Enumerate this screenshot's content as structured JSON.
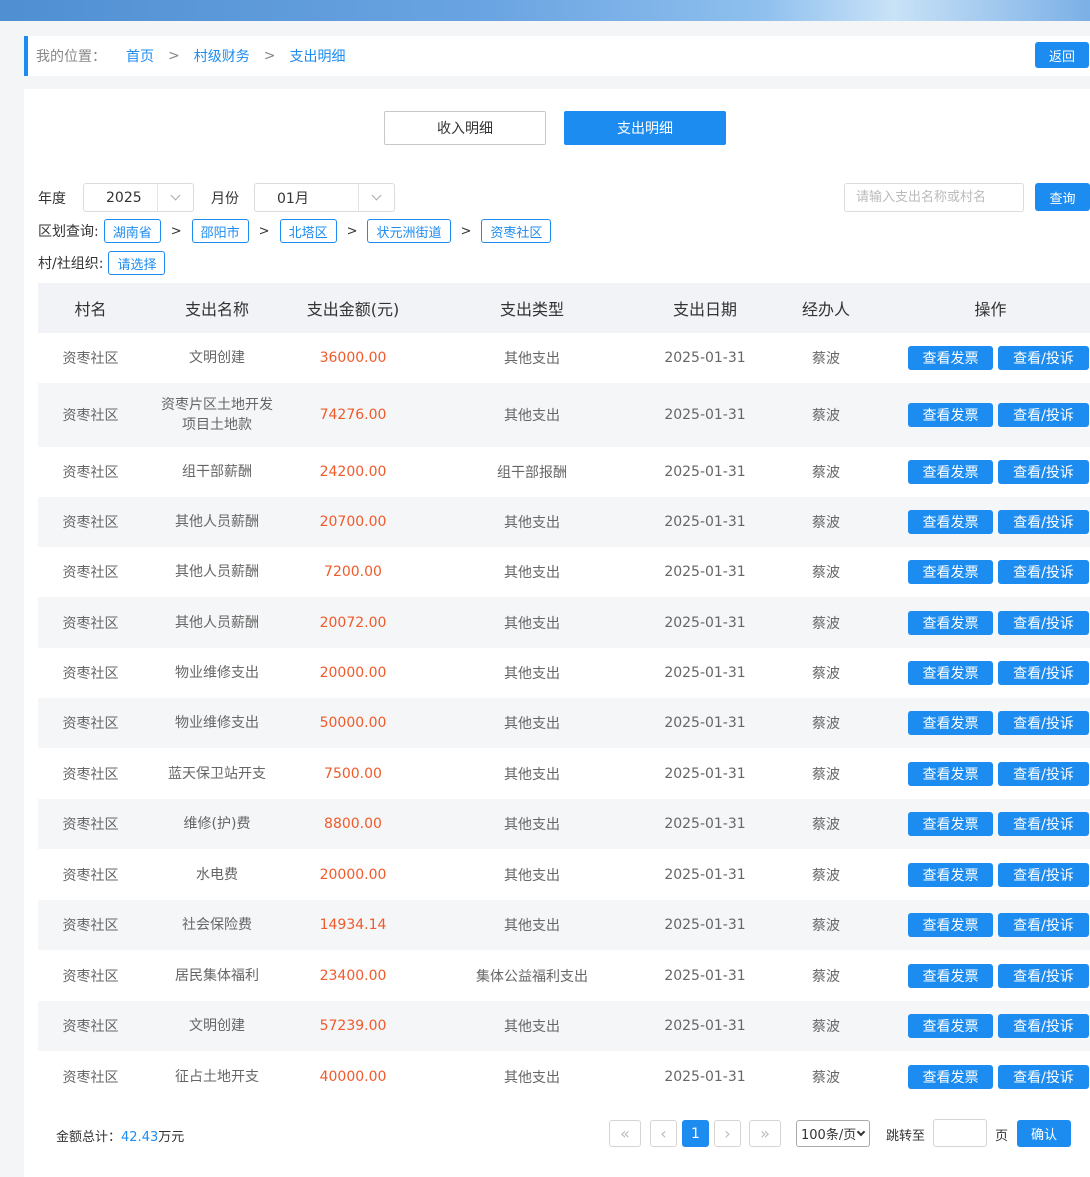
{
  "breadcrumb": {
    "label": "我的位置：",
    "items": [
      "首页",
      "村级财务",
      "支出明细"
    ],
    "separator": ">",
    "back_label": "返回"
  },
  "tabs": {
    "income_label": "收入明细",
    "expense_label": "支出明细"
  },
  "filters": {
    "year_label": "年度",
    "year_value": "2025",
    "month_label": "月份",
    "month_value": "01月",
    "search_placeholder": "请输入支出名称或村名",
    "query_label": "查询",
    "region_label": "区划查询:",
    "regions": [
      "湖南省",
      "邵阳市",
      "北塔区",
      "状元洲街道",
      "资枣社区"
    ],
    "region_sep": ">",
    "org_label": "村/社组织:",
    "org_value": "请选择"
  },
  "table": {
    "headers": [
      "村名",
      "支出名称",
      "支出金额(元)",
      "支出类型",
      "支出日期",
      "经办人",
      "操作"
    ],
    "invoice_label": "查看发票",
    "complain_label": "查看/投诉",
    "rows": [
      {
        "village": "资枣社区",
        "name": "文明创建",
        "amount": "36000.00",
        "type": "其他支出",
        "date": "2025-01-31",
        "handler": "蔡波"
      },
      {
        "village": "资枣社区",
        "name": "资枣片区土地开发项目土地款",
        "amount": "74276.00",
        "type": "其他支出",
        "date": "2025-01-31",
        "handler": "蔡波"
      },
      {
        "village": "资枣社区",
        "name": "组干部薪酬",
        "amount": "24200.00",
        "type": "组干部报酬",
        "date": "2025-01-31",
        "handler": "蔡波"
      },
      {
        "village": "资枣社区",
        "name": "其他人员薪酬",
        "amount": "20700.00",
        "type": "其他支出",
        "date": "2025-01-31",
        "handler": "蔡波"
      },
      {
        "village": "资枣社区",
        "name": "其他人员薪酬",
        "amount": "7200.00",
        "type": "其他支出",
        "date": "2025-01-31",
        "handler": "蔡波"
      },
      {
        "village": "资枣社区",
        "name": "其他人员薪酬",
        "amount": "20072.00",
        "type": "其他支出",
        "date": "2025-01-31",
        "handler": "蔡波"
      },
      {
        "village": "资枣社区",
        "name": "物业维修支出",
        "amount": "20000.00",
        "type": "其他支出",
        "date": "2025-01-31",
        "handler": "蔡波"
      },
      {
        "village": "资枣社区",
        "name": "物业维修支出",
        "amount": "50000.00",
        "type": "其他支出",
        "date": "2025-01-31",
        "handler": "蔡波"
      },
      {
        "village": "资枣社区",
        "name": "蓝天保卫站开支",
        "amount": "7500.00",
        "type": "其他支出",
        "date": "2025-01-31",
        "handler": "蔡波"
      },
      {
        "village": "资枣社区",
        "name": "维修(护)费",
        "amount": "8800.00",
        "type": "其他支出",
        "date": "2025-01-31",
        "handler": "蔡波"
      },
      {
        "village": "资枣社区",
        "name": "水电费",
        "amount": "20000.00",
        "type": "其他支出",
        "date": "2025-01-31",
        "handler": "蔡波"
      },
      {
        "village": "资枣社区",
        "name": "社会保险费",
        "amount": "14934.14",
        "type": "其他支出",
        "date": "2025-01-31",
        "handler": "蔡波"
      },
      {
        "village": "资枣社区",
        "name": "居民集体福利",
        "amount": "23400.00",
        "type": "集体公益福利支出",
        "date": "2025-01-31",
        "handler": "蔡波"
      },
      {
        "village": "资枣社区",
        "name": "文明创建",
        "amount": "57239.00",
        "type": "其他支出",
        "date": "2025-01-31",
        "handler": "蔡波"
      },
      {
        "village": "资枣社区",
        "name": "征占土地开支",
        "amount": "40000.00",
        "type": "其他支出",
        "date": "2025-01-31",
        "handler": "蔡波"
      }
    ]
  },
  "footer": {
    "total_label": "金额总计：",
    "total_value": "42.43",
    "total_unit": "万元",
    "current_page": "1",
    "page_size": "100条/页",
    "jump_label": "跳转至",
    "page_unit": "页",
    "confirm_label": "确认"
  },
  "colors": {
    "accent": "#1d8cf0",
    "amount": "#f05a2a"
  }
}
